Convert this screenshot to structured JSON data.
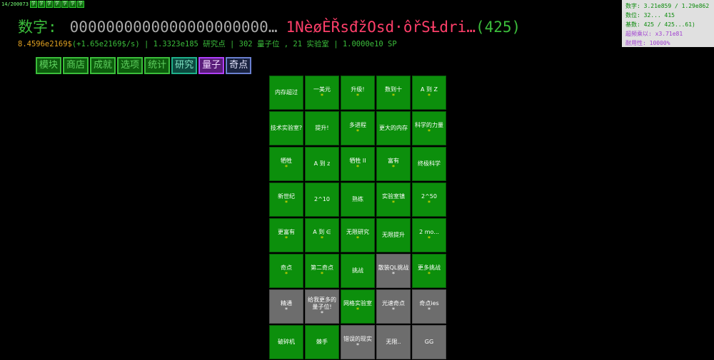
{
  "topleft": {
    "counter": "14/200073",
    "dots": [
      "学",
      "学",
      "学",
      "学",
      "学",
      "学",
      "学"
    ]
  },
  "number": {
    "label": "数字:",
    "digits": "0000000000000000000000",
    "ellipsis": "…",
    "glitch": "1NèøÈŘsđžOsd·ôřSȽdri…",
    "count": "(425)"
  },
  "stats": {
    "money": "8.4596e2169$",
    "gain": "(+1.65e2169$/s)",
    "rest": "| 1.3323e185 研究点 | 302 量子位 , 21 实验室 | 1.0000e10 SP"
  },
  "tabs": [
    {
      "label": "模块",
      "variant": ""
    },
    {
      "label": "商店",
      "variant": ""
    },
    {
      "label": "成就",
      "variant": ""
    },
    {
      "label": "选项",
      "variant": ""
    },
    {
      "label": "统计",
      "variant": ""
    },
    {
      "label": "研究",
      "variant": "research"
    },
    {
      "label": "量子",
      "variant": "quantum"
    },
    {
      "label": "奇点",
      "variant": "singular"
    }
  ],
  "research_grid": [
    {
      "label": "内存超过",
      "star": "",
      "color": "g"
    },
    {
      "label": "一美元",
      "star": "*",
      "color": "g"
    },
    {
      "label": "升级!",
      "star": "*",
      "color": "g"
    },
    {
      "label": "数到十",
      "star": "*",
      "color": "g"
    },
    {
      "label": "A 到 Z",
      "star": "*",
      "color": "g"
    },
    {
      "label": "技术实验室?",
      "star": "",
      "color": "g"
    },
    {
      "label": "提升!",
      "star": "",
      "color": "g"
    },
    {
      "label": "多进程",
      "star": "*",
      "color": "g"
    },
    {
      "label": "更大的内存",
      "star": "",
      "color": "g"
    },
    {
      "label": "科学的力量",
      "star": "*",
      "color": "g"
    },
    {
      "label": "牺牲",
      "star": "*",
      "color": "g"
    },
    {
      "label": "A 到 z",
      "star": "",
      "color": "g"
    },
    {
      "label": "牺牲 II",
      "star": "*",
      "color": "g"
    },
    {
      "label": "富有",
      "star": "*",
      "color": "g"
    },
    {
      "label": "终极科学",
      "star": "",
      "color": "g"
    },
    {
      "label": "新世纪",
      "star": "*",
      "color": "g"
    },
    {
      "label": "2^10",
      "star": "",
      "color": "g"
    },
    {
      "label": "熟练",
      "star": "",
      "color": "g"
    },
    {
      "label": "实验室镇",
      "star": "*",
      "color": "g"
    },
    {
      "label": "2^50",
      "star": "*",
      "color": "g"
    },
    {
      "label": "更富有",
      "star": "*",
      "color": "g"
    },
    {
      "label": "A 到 ∈",
      "star": "*",
      "color": "g"
    },
    {
      "label": "无限研究",
      "star": "*",
      "color": "g"
    },
    {
      "label": "无限提升",
      "star": "",
      "color": "g"
    },
    {
      "label": "2 mo...",
      "star": "*",
      "color": "g"
    },
    {
      "label": "奇点",
      "star": "*",
      "color": "g"
    },
    {
      "label": "第二奇点",
      "star": "*",
      "color": "g"
    },
    {
      "label": "挑战",
      "star": "",
      "color": "g"
    },
    {
      "label": "散装QL挑战",
      "star": "*",
      "color": "gr"
    },
    {
      "label": "更多挑战",
      "star": "*",
      "color": "g"
    },
    {
      "label": "精通",
      "star": "*",
      "color": "gr"
    },
    {
      "label": "给我更多的量子位!",
      "star": "*",
      "color": "gr"
    },
    {
      "label": "网格实验室",
      "star": "*",
      "color": "g"
    },
    {
      "label": "光速奇点",
      "star": "*",
      "color": "gr"
    },
    {
      "label": "奇点ies",
      "star": "*",
      "color": "gr"
    },
    {
      "label": "破碎机",
      "star": "",
      "color": "g"
    },
    {
      "label": "棘手",
      "star": "",
      "color": "g"
    },
    {
      "label": "错误的现实",
      "star": "*",
      "color": "gr"
    },
    {
      "label": "无限..",
      "star": "",
      "color": "gr"
    },
    {
      "label": "GG",
      "star": "",
      "color": "gr"
    }
  ],
  "panel": {
    "line1": "数字: 3.21e859 / 1.29e862",
    "line2": "数位: 32... 415",
    "line3": "基数: 425 / 425...61)",
    "line4": "超频乘以: x3.71e81",
    "line5": "耐用性: 10000%"
  }
}
